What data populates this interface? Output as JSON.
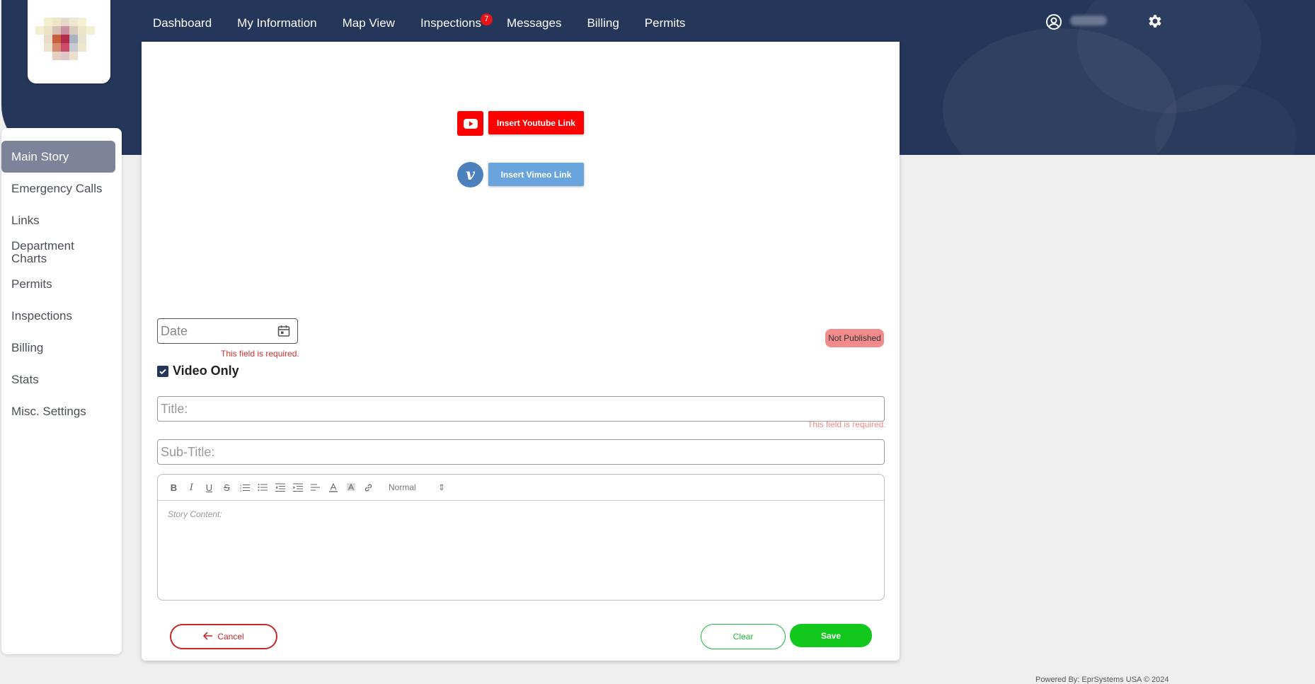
{
  "nav": {
    "items": [
      {
        "label": "Dashboard"
      },
      {
        "label": "My Information"
      },
      {
        "label": "Map View"
      },
      {
        "label": "Inspections",
        "badge": "7"
      },
      {
        "label": "Messages"
      },
      {
        "label": "Billing"
      },
      {
        "label": "Permits"
      }
    ]
  },
  "header": {
    "user_icon": "user-circle-icon",
    "settings_icon": "gear-icon"
  },
  "sidebar": {
    "items": [
      {
        "label": "Main Story",
        "active": true
      },
      {
        "label": "Emergency Calls"
      },
      {
        "label": "Links"
      },
      {
        "label": "Department Charts"
      },
      {
        "label": "Permits"
      },
      {
        "label": "Inspections"
      },
      {
        "label": "Billing"
      },
      {
        "label": "Stats"
      },
      {
        "label": "Misc. Settings"
      }
    ]
  },
  "media": {
    "youtube_label": "Insert Youtube Link",
    "vimeo_label": "Insert Vimeo Link"
  },
  "form": {
    "date_placeholder": "Date",
    "date_error": "This field is required.",
    "status_badge": "Not Published",
    "video_only_label": "Video Only",
    "video_only_checked": true,
    "title_placeholder": "Title:",
    "title_error": "This field is required.",
    "subtitle_placeholder": "Sub-Title:",
    "content_placeholder": "Story Content:",
    "format_select": "Normal"
  },
  "actions": {
    "cancel": "Cancel",
    "clear": "Clear",
    "save": "Save"
  },
  "footer": {
    "text": "Powered By: EprSystems USA © 2024"
  },
  "colors": {
    "header_bg": "#243659",
    "active_sidebar": "#7d8398",
    "youtube": "#ff0000",
    "vimeo": "#69a4dd",
    "save": "#12c81c",
    "cancel": "#c62828",
    "not_published": "#f28b8b"
  }
}
